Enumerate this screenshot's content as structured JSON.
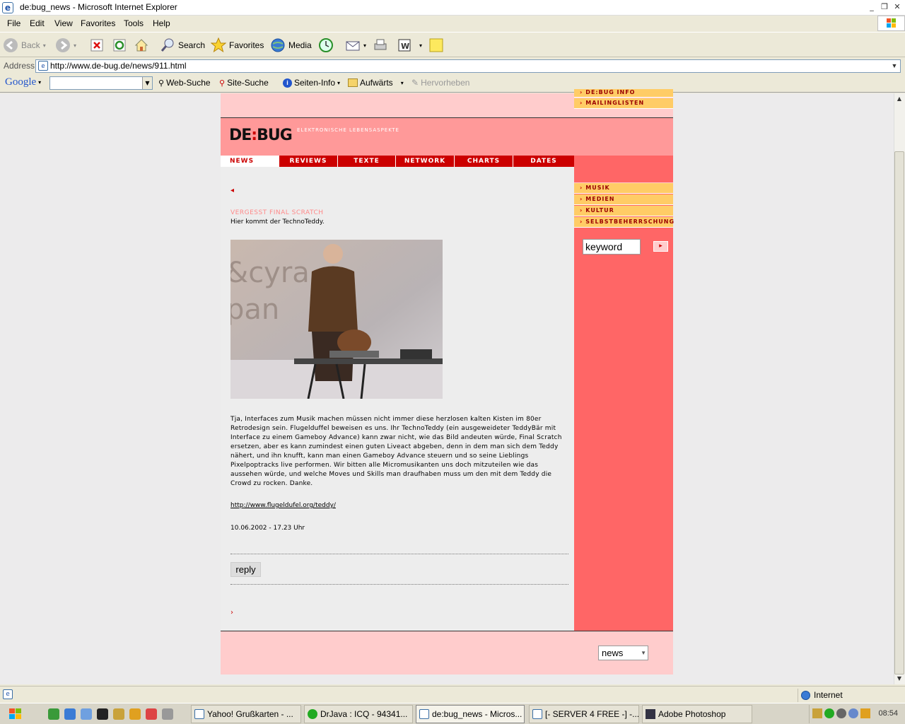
{
  "window": {
    "title": "de:bug_news - Microsoft Internet Explorer",
    "controls": [
      "minimize",
      "restore",
      "close"
    ]
  },
  "menu": [
    "File",
    "Edit",
    "View",
    "Favorites",
    "Tools",
    "Help"
  ],
  "toolbar": {
    "back": "Back",
    "search": "Search",
    "favorites": "Favorites",
    "media": "Media"
  },
  "address": {
    "label": "Address",
    "url": "http://www.de-bug.de/news/911.html"
  },
  "googlebar": {
    "logo": "Google",
    "search_value": "",
    "web_search": "Web-Suche",
    "site_search": "Site-Suche",
    "page_info": "Seiten-Info",
    "up": "Aufwärts",
    "highlight": "Hervorheben"
  },
  "site": {
    "logo_left": "DE",
    "logo_colon": ":",
    "logo_right": "BUG",
    "tagline": "ELEKTRONISCHE LEBENSASPEKTE",
    "top_links": [
      "DE:BUG INFO",
      "MAILINGLISTEN"
    ],
    "nav_tabs": [
      "NEWS",
      "REVIEWS",
      "TEXTE",
      "NETWORK",
      "CHARTS",
      "DATES"
    ],
    "side_links": [
      "MUSIK",
      "MEDIEN",
      "KULTUR",
      "SELBSTBEHERRSCHUNG"
    ],
    "search_value": "keyword",
    "section_select": "news",
    "colors": {
      "accent_red": "#cc0000",
      "header_pink": "#ff9999",
      "sidebar_red": "#ff6666",
      "light_pink": "#ffcccc",
      "link_yellow": "#ffcc66"
    }
  },
  "article": {
    "headline": "VERGESST FINAL SCRATCH",
    "subhead": "Hier kommt der TechnoTeddy.",
    "body": "Tja, Interfaces zum Musik machen müssen nicht immer diese herzlosen kalten Kisten im 80er Retrodesign sein. Flugelduffel beweisen es uns. Ihr TechnoTeddy (ein ausgeweideter TeddyBär mit Interface zu einem Gameboy Advance) kann zwar nicht, wie das Bild andeuten würde, Final Scratch ersetzen, aber es kann zumindest einen guten Liveact abgeben, denn in dem man sich dem Teddy nähert, und ihn knufft, kann man einen Gameboy Advance steuern und so seine Lieblings Pixelpoptracks live performen. Wir bitten alle Micromusikanten uns doch mitzuteilen wie das aussehen würde, und welche Moves und Skills man draufhaben muss um den mit dem Teddy die Crowd zu rocken. Danke.",
    "link": "http://www.flugeldufel.org/teddy/",
    "date": "10.06.2002 - 17.23 Uhr",
    "reply": "reply"
  },
  "status": {
    "zone": "Internet"
  },
  "taskbar": {
    "tasks": [
      "Yahoo! Grußkarten - ...",
      "DrJava : ICQ - 94341...",
      "de:bug_news - Micros...",
      "[- SERVER 4 FREE -] -...",
      "Adobe Photoshop"
    ],
    "clock": "08:54"
  }
}
